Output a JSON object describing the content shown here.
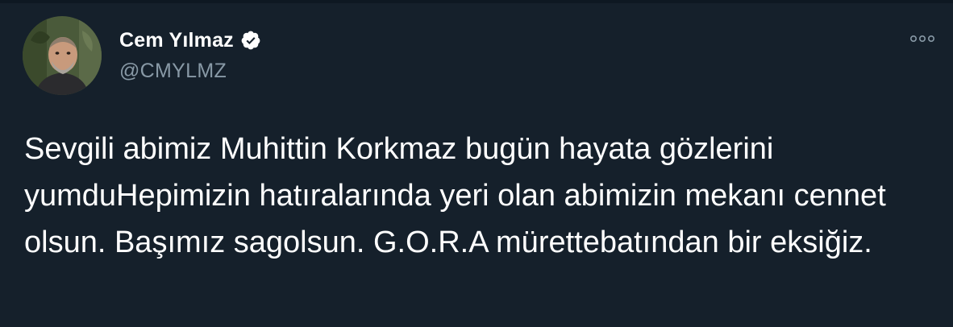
{
  "author": {
    "display_name": "Cem Yılmaz",
    "handle": "@CMYLMZ",
    "verified": true,
    "avatar_icon": "profile-photo"
  },
  "actions": {
    "more_icon": "more-options-icon"
  },
  "tweet": {
    "text": "Sevgili abimiz Muhittin Korkmaz bugün hayata gözlerini yumduHepimizin hatıralarında yeri olan abimizin mekanı cennet olsun. Başımız sagolsun. G.O.R.A mürettebatından bir eksiğiz."
  },
  "colors": {
    "background": "#15202b",
    "primary_text": "#ffffff",
    "secondary_text": "#8899a6"
  }
}
